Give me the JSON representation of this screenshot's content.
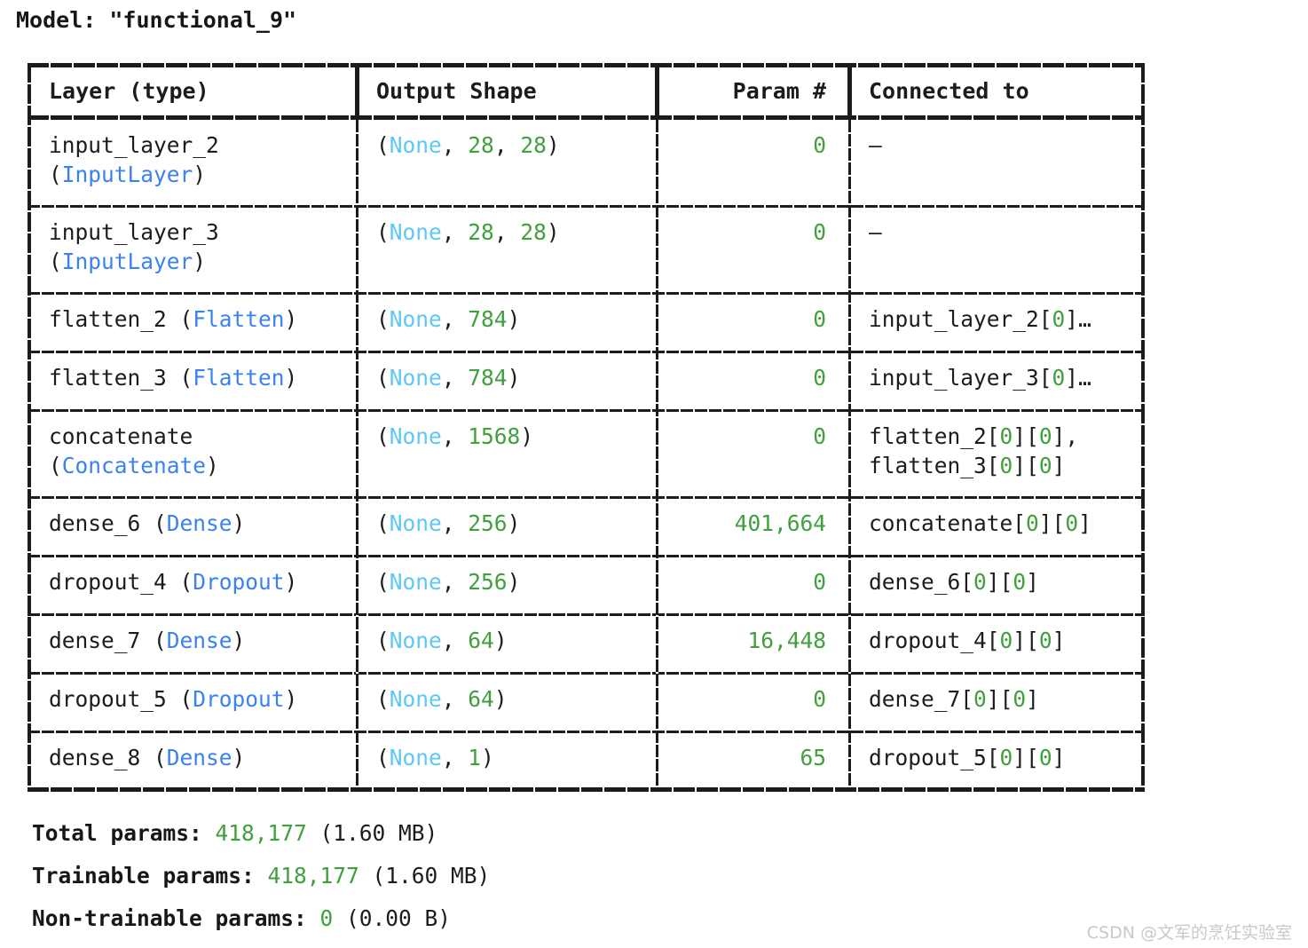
{
  "model_title": "Model: \"functional_9\"",
  "colors": {
    "layer_type": "#3b82f1",
    "none_token": "#5ec8f2",
    "number": "#3fa03c",
    "text": "#1c1c1c",
    "watermark": "#c8c8c8"
  },
  "table": {
    "headers": [
      "Layer (type)",
      "Output Shape",
      "Param #",
      "Connected to"
    ],
    "rows": [
      {
        "layer_name": "input_layer_2",
        "layer_type": "InputLayer",
        "name_wrapped": true,
        "shape_tokens": [
          "(",
          "None",
          ", ",
          "28",
          ", ",
          "28",
          ")"
        ],
        "param": "0",
        "connected_to": [
          "—"
        ]
      },
      {
        "layer_name": "input_layer_3",
        "layer_type": "InputLayer",
        "name_wrapped": true,
        "shape_tokens": [
          "(",
          "None",
          ", ",
          "28",
          ", ",
          "28",
          ")"
        ],
        "param": "0",
        "connected_to": [
          "—"
        ]
      },
      {
        "layer_name": "flatten_2",
        "layer_type": "Flatten",
        "name_wrapped": false,
        "shape_tokens": [
          "(",
          "None",
          ", ",
          "784",
          ")"
        ],
        "param": "0",
        "connected_to": [
          "input_layer_2[0]…"
        ]
      },
      {
        "layer_name": "flatten_3",
        "layer_type": "Flatten",
        "name_wrapped": false,
        "shape_tokens": [
          "(",
          "None",
          ", ",
          "784",
          ")"
        ],
        "param": "0",
        "connected_to": [
          "input_layer_3[0]…"
        ]
      },
      {
        "layer_name": "concatenate",
        "layer_type": "Concatenate",
        "name_wrapped": true,
        "shape_tokens": [
          "(",
          "None",
          ", ",
          "1568",
          ")"
        ],
        "param": "0",
        "connected_to": [
          "flatten_2[0][0],",
          "flatten_3[0][0]"
        ]
      },
      {
        "layer_name": "dense_6",
        "layer_type": "Dense",
        "name_wrapped": false,
        "shape_tokens": [
          "(",
          "None",
          ", ",
          "256",
          ")"
        ],
        "param": "401,664",
        "connected_to": [
          "concatenate[0][0]"
        ]
      },
      {
        "layer_name": "dropout_4",
        "layer_type": "Dropout",
        "name_wrapped": false,
        "shape_tokens": [
          "(",
          "None",
          ", ",
          "256",
          ")"
        ],
        "param": "0",
        "connected_to": [
          "dense_6[0][0]"
        ]
      },
      {
        "layer_name": "dense_7",
        "layer_type": "Dense",
        "name_wrapped": false,
        "shape_tokens": [
          "(",
          "None",
          ", ",
          "64",
          ")"
        ],
        "param": "16,448",
        "connected_to": [
          "dropout_4[0][0]"
        ]
      },
      {
        "layer_name": "dropout_5",
        "layer_type": "Dropout",
        "name_wrapped": false,
        "shape_tokens": [
          "(",
          "None",
          ", ",
          "64",
          ")"
        ],
        "param": "0",
        "connected_to": [
          "dense_7[0][0]"
        ]
      },
      {
        "layer_name": "dense_8",
        "layer_type": "Dense",
        "name_wrapped": false,
        "shape_tokens": [
          "(",
          "None",
          ", ",
          "1",
          ")"
        ],
        "param": "65",
        "connected_to": [
          "dropout_5[0][0]"
        ]
      }
    ]
  },
  "footer": [
    {
      "label": "Total params:",
      "value": "418,177",
      "size": "(1.60 MB)"
    },
    {
      "label": "Trainable params:",
      "value": "418,177",
      "size": "(1.60 MB)"
    },
    {
      "label": "Non-trainable params:",
      "value": "0",
      "size": "(0.00 B)"
    }
  ],
  "watermark": "CSDN @文军的烹饪实验室"
}
